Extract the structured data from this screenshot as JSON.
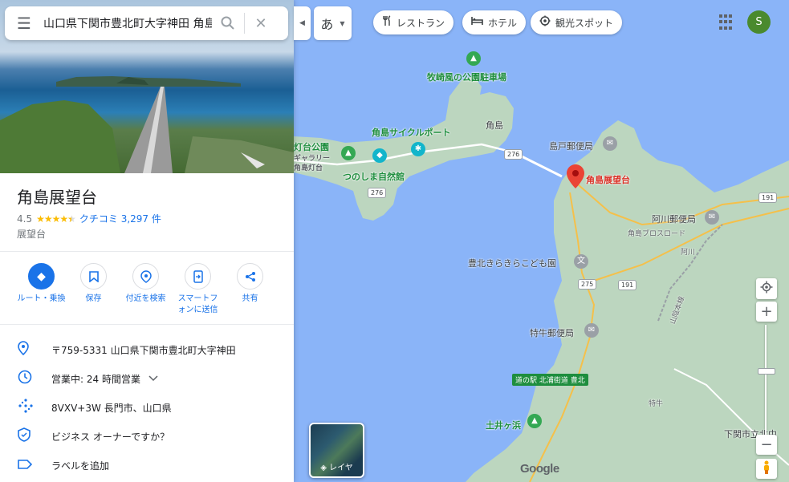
{
  "search": {
    "value": "山口県下関市豊北町大字神田 角島",
    "menu_icon": "menu-icon",
    "search_icon": "search-icon",
    "close_icon": "close-icon"
  },
  "place": {
    "title": "角島展望台",
    "rating": "4.5",
    "rating_stars": 4.5,
    "reviews": "クチコミ 3,297 件",
    "category": "展望台"
  },
  "actions": [
    {
      "label": "ルート・乗換",
      "icon": "directions-icon"
    },
    {
      "label": "保存",
      "icon": "bookmark-icon"
    },
    {
      "label": "付近を検索",
      "icon": "nearby-icon"
    },
    {
      "label": "スマートフォンに送信",
      "icon": "send-to-phone-icon"
    },
    {
      "label": "共有",
      "icon": "share-icon"
    }
  ],
  "info": {
    "address": "〒759-5331 山口県下関市豊北町大字神田",
    "hours": "営業中:  24 時間営業",
    "plus_code": "8VXV+3W 長門市、山口県",
    "owner": "ビジネス オーナーですか？",
    "add_label": "ラベルを追加"
  },
  "topbar": {
    "ime": "あ",
    "chips": [
      {
        "label": "レストラン",
        "icon": "restaurant-icon"
      },
      {
        "label": "ホテル",
        "icon": "hotel-icon"
      },
      {
        "label": "観光スポット",
        "icon": "attraction-icon"
      }
    ],
    "avatar": "S"
  },
  "map": {
    "labels": {
      "makisaki": "牧崎風の公園駐車場",
      "cycle": "角島サイクルポート",
      "tsunoshima_town": "角島",
      "lighthouse": "灯台公園",
      "lighthouse_sub1": "ギャラリー",
      "lighthouse_sub2": "角島灯台",
      "nature": "つのしま自然館",
      "shimado_po": "島戸郵便局",
      "selected": "角島展望台",
      "agawa_po": "阿川郵便局",
      "agawa": "阿川",
      "road_name": "角島ブロスロード",
      "kodomoen": "豊北きらきらこども園",
      "tokugyu_po": "特牛郵便局",
      "station_badge": "道の駅 北浦街道 豊北",
      "tokugyu": "特牛",
      "doigahama": "土井ヶ浜",
      "shimonoseki": "下関市立北中",
      "line": "山陰本線"
    },
    "roads": [
      "276",
      "276",
      "191",
      "275",
      "191"
    ],
    "layers_label": "レイヤ"
  },
  "brand": {
    "logo": "Google"
  }
}
